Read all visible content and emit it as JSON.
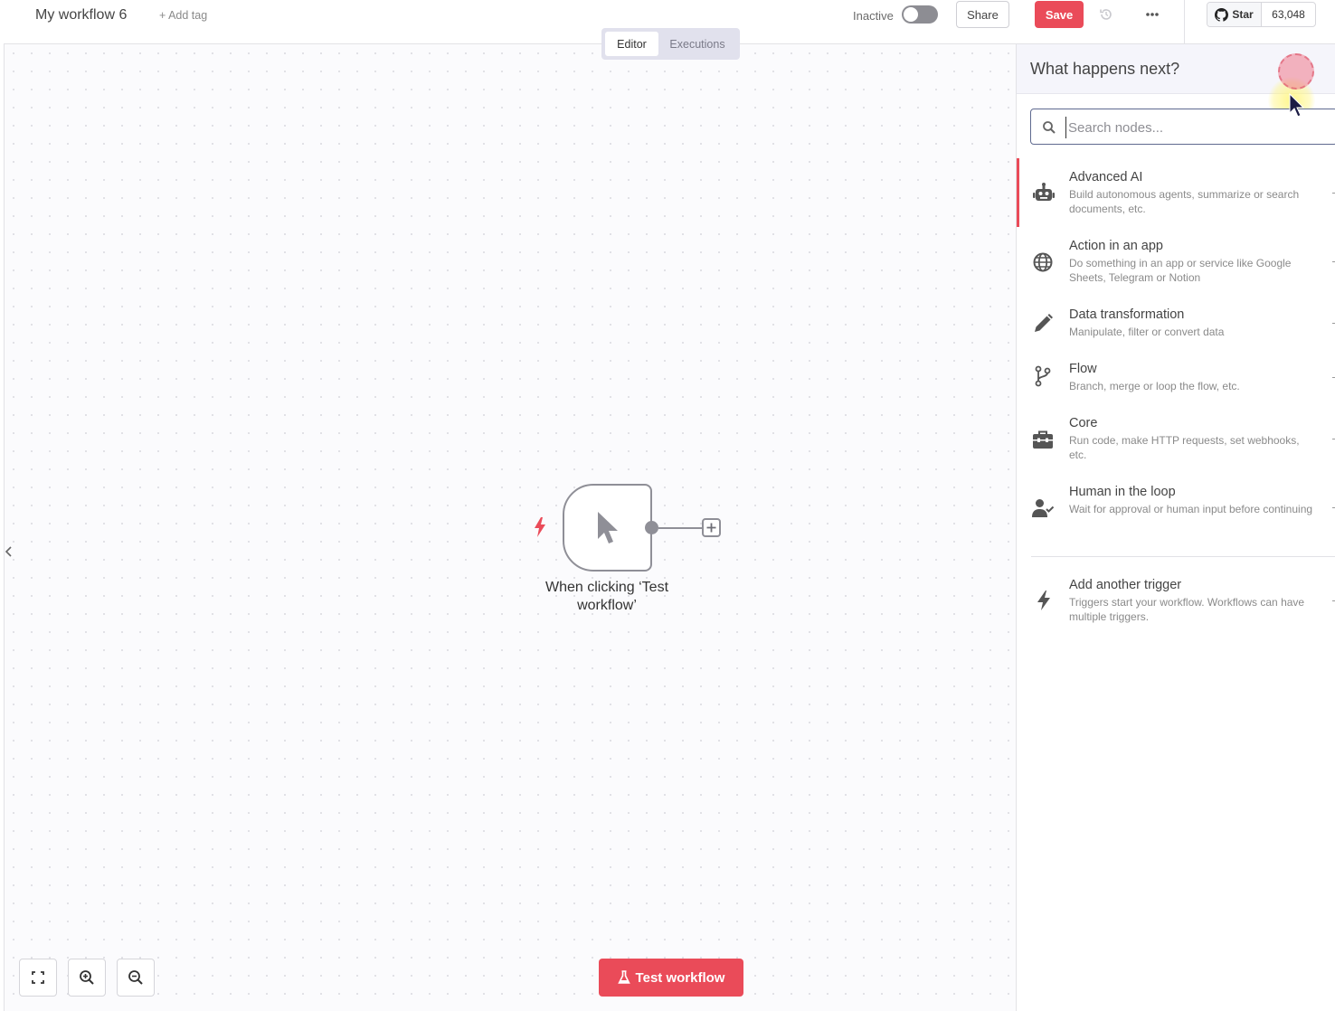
{
  "header": {
    "workflow_name": "My workflow 6",
    "add_tag": "+ Add tag",
    "status_label": "Inactive",
    "share_label": "Share",
    "save_label": "Save",
    "github_star_label": "Star",
    "github_star_count": "63,048"
  },
  "tabs": [
    {
      "label": "Editor",
      "active": true
    },
    {
      "label": "Executions",
      "active": false
    }
  ],
  "canvas": {
    "node_label": "When clicking ‘Test workflow’",
    "test_button_label": "Test workflow"
  },
  "panel": {
    "title": "What happens next?",
    "search_placeholder": "Search nodes...",
    "categories": [
      {
        "title": "Advanced AI",
        "desc": "Build autonomous agents, summarize or search documents, etc.",
        "icon": "robot-icon"
      },
      {
        "title": "Action in an app",
        "desc": "Do something in an app or service like Google Sheets, Telegram or Notion",
        "icon": "globe-icon"
      },
      {
        "title": "Data transformation",
        "desc": "Manipulate, filter or convert data",
        "icon": "pen-icon"
      },
      {
        "title": "Flow",
        "desc": "Branch, merge or loop the flow, etc.",
        "icon": "branch-icon"
      },
      {
        "title": "Core",
        "desc": "Run code, make HTTP requests, set webhooks, etc.",
        "icon": "toolbox-icon"
      },
      {
        "title": "Human in the loop",
        "desc": "Wait for approval or human input before continuing",
        "icon": "user-check-icon"
      }
    ],
    "trigger": {
      "title": "Add another trigger",
      "desc": "Triggers start your workflow. Workflows can have multiple triggers.",
      "icon": "bolt-icon"
    }
  },
  "colors": {
    "accent": "#ea4b59",
    "tab_bg": "#e1e1ed",
    "node_border": "#8f8f97"
  }
}
